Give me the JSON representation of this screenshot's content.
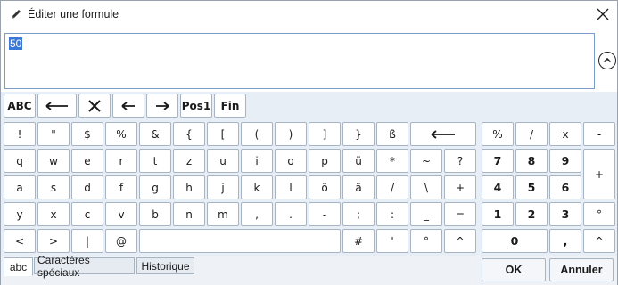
{
  "dialog": {
    "title": "Éditer une formule",
    "title_icon": "pencil-icon",
    "close_icon": "close-icon"
  },
  "formula": {
    "value": "50",
    "collapse_icon": "chevron-up-circle-icon"
  },
  "toolbar": {
    "abc_label": "ABC",
    "backspace_icon": "backspace-arrow-icon",
    "clear_icon": "clear-x-icon",
    "left_icon": "arrow-left-icon",
    "right_icon": "arrow-right-icon",
    "home_label": "Pos1",
    "end_label": "Fin"
  },
  "keys": {
    "row1": [
      "!",
      "\"",
      "$",
      "%",
      "&",
      "{",
      "[",
      "(",
      ")",
      "]",
      "}",
      "ß"
    ],
    "row2": [
      "q",
      "w",
      "e",
      "r",
      "t",
      "z",
      "u",
      "i",
      "o",
      "p",
      "ü",
      "*",
      "~",
      "?"
    ],
    "row3": [
      "a",
      "s",
      "d",
      "f",
      "g",
      "h",
      "j",
      "k",
      "l",
      "ö",
      "ä",
      "/",
      "\\",
      "+"
    ],
    "row4": [
      "y",
      "x",
      "c",
      "v",
      "b",
      "n",
      "m",
      ",",
      ".",
      "-",
      ";",
      ":",
      "_",
      "="
    ],
    "row5_left": [
      "<",
      ">",
      "|",
      "@"
    ],
    "row5_right": [
      "#",
      "'",
      "°",
      "^"
    ],
    "row1_backspace_icon": "backspace-arrow-icon"
  },
  "numpad": {
    "row1": [
      "%",
      "/",
      "x",
      "-"
    ],
    "row2": [
      "7",
      "8",
      "9"
    ],
    "row3": [
      "4",
      "5",
      "6"
    ],
    "row4": [
      "1",
      "2",
      "3",
      "°"
    ],
    "row5": [
      "0",
      ",",
      "^"
    ],
    "plus": "+"
  },
  "tabs": {
    "abc": "abc",
    "special": "Caractères spéciaux",
    "history": "Historique"
  },
  "actions": {
    "ok": "OK",
    "cancel": "Annuler"
  }
}
